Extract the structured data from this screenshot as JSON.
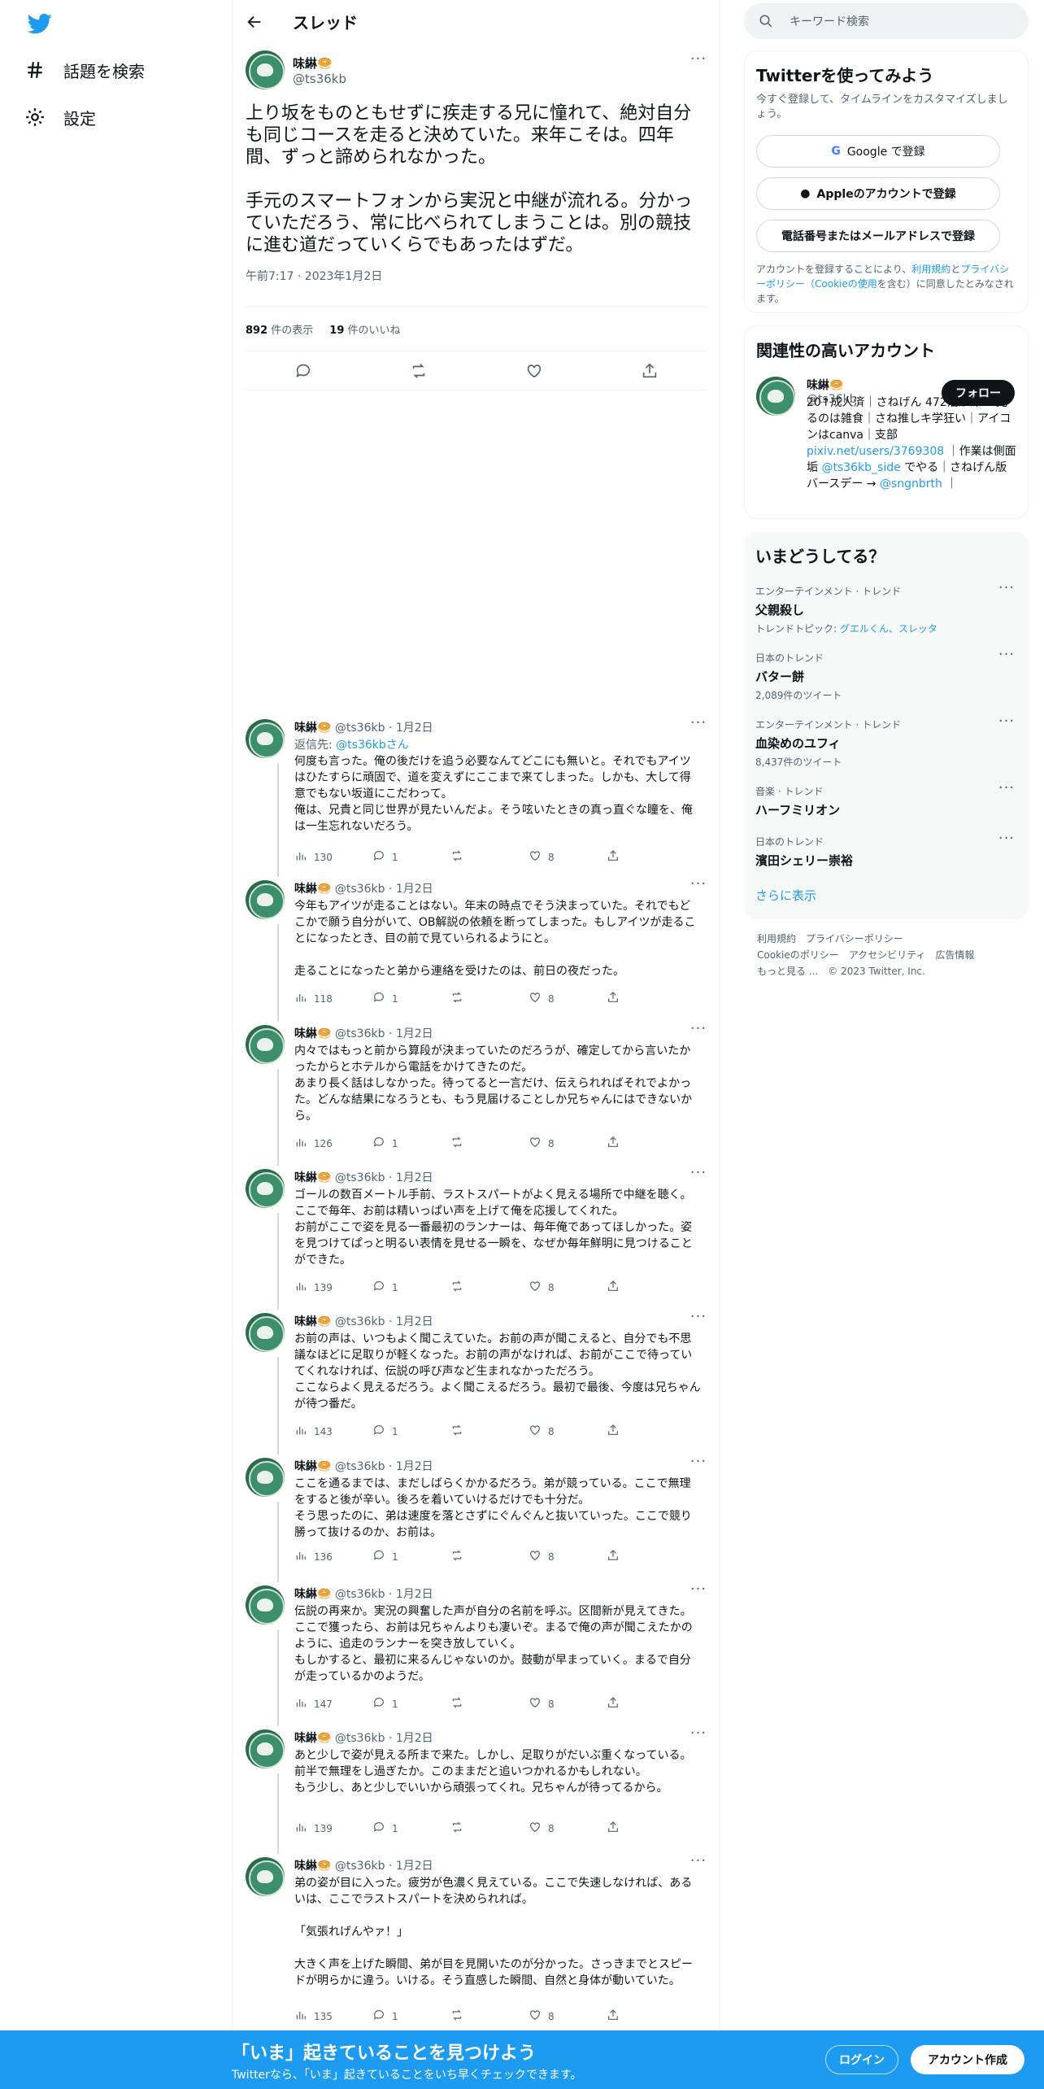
{
  "nav": {
    "explore_label": "話題を検索",
    "settings_label": "設定"
  },
  "header": {
    "title": "スレッド"
  },
  "main_tweet": {
    "name": "味綝🥯",
    "handle": "@ts36kb",
    "text": "上り坂をものともせずに疾走する兄に憧れて、絶対自分も同じコースを走ると決めていた。来年こそは。四年間、ずっと諦められなかった。\n\n手元のスマートフォンから実況と中継が流れる。分かっていただろう、常に比べられてしまうことは。別の競技に進む道だっていくらでもあったはずだ。",
    "time": "午前7:17 · 2023年1月2日",
    "views_count": "892",
    "views_label": " 件の表示",
    "likes_count": "19",
    "likes_label": " 件のいいね"
  },
  "reply_meta": {
    "name": "味綝🥯",
    "handle": "@ts36kb · 1月2日",
    "reply_to_prefix": "返信先: ",
    "reply_to_user": "@ts36kbさん"
  },
  "replies": [
    {
      "text": "何度も言った。俺の後だけを追う必要なんてどこにも無いと。それでもアイツはひたすらに頑固で、道を変えずにここまで来てしまった。しかも、大して得意でもない坂道にこだわって。\n俺は、兄貴と同じ世界が見たいんだよ。そう呟いたときの真っ直ぐな瞳を、俺は一生忘れないだろう。",
      "views": "130",
      "replies": "1",
      "likes": "8"
    },
    {
      "text": "今年もアイツが走ることはない。年末の時点でそう決まっていた。それでもどこかで願う自分がいて、OB解説の依頼を断ってしまった。もしアイツが走ることになったとき、目の前で見ていられるようにと。\n\n走ることになったと弟から連絡を受けたのは、前日の夜だった。",
      "views": "118",
      "replies": "1",
      "likes": "8"
    },
    {
      "text": "内々ではもっと前から算段が決まっていたのだろうが、確定してから言いたかったからとホテルから電話をかけてきたのだ。\nあまり長く話はしなかった。待ってると一言だけ、伝えられればそれでよかった。どんな結果になろうとも、もう見届けることしか兄ちゃんにはできないから。",
      "views": "126",
      "replies": "1",
      "likes": "8"
    },
    {
      "text": "ゴールの数百メートル手前、ラストスパートがよく見える場所で中継を聴く。ここで毎年、お前は精いっぱい声を上げて俺を応援してくれた。\nお前がここで姿を見る一番最初のランナーは、毎年俺であってほしかった。姿を見つけてぱっと明るい表情を見せる一瞬を、なぜか毎年鮮明に見つけることができた。",
      "views": "139",
      "replies": "1",
      "likes": "8"
    },
    {
      "text": "お前の声は、いつもよく聞こえていた。お前の声が聞こえると、自分でも不思議なほどに足取りが軽くなった。お前の声がなければ、お前がここで待っていてくれなければ、伝説の呼び声など生まれなかっただろう。\nここならよく見えるだろう。よく聞こえるだろう。最初で最後、今度は兄ちゃんが待つ番だ。",
      "views": "143",
      "replies": "1",
      "likes": "8"
    },
    {
      "text": "ここを通るまでは、まだしばらくかかるだろう。弟が競っている。ここで無理をすると後が辛い。後ろを着いていけるだけでも十分だ。\nそう思ったのに、弟は速度を落とさずにぐんぐんと抜いていった。ここで競り勝って抜けるのか、お前は。",
      "views": "136",
      "replies": "1",
      "likes": "8"
    },
    {
      "text": "伝説の再来か。実況の興奮した声が自分の名前を呼ぶ。区間新が見えてきた。ここで獲ったら、お前は兄ちゃんよりも凄いぞ。まるで俺の声が聞こえたかのように、追走のランナーを突き放していく。\nもしかすると、最初に来るんじゃないのか。鼓動が早まっていく。まるで自分が走っているかのようだ。",
      "views": "147",
      "replies": "1",
      "likes": "8"
    },
    {
      "text": "あと少しで姿が見える所まで来た。しかし、足取りがだいぶ重くなっている。前半で無理をし過ぎたか。このままだと追いつかれるかもしれない。\nもう少し、あと少しでいいから頑張ってくれ。兄ちゃんが待ってるから。",
      "views": "139",
      "replies": "1",
      "likes": "8"
    },
    {
      "text": "弟の姿が目に入った。疲労が色濃く見えている。ここで失速しなければ、あるいは、ここでラストスパートを決められれば。\n\n「気張れげんやァ！」\n\n大きく声を上げた瞬間、弟が目を見開いたのが分かった。さっきまでとスピードが明らかに違う。いける。そう直感した瞬間、自然と身体が動いていた。",
      "views": "135",
      "replies": "1",
      "likes": "8"
    }
  ],
  "sidebar": {
    "search_placeholder": "キーワード検索",
    "signup": {
      "title": "Twitterを使ってみよう",
      "desc": "今すぐ登録して、タイムラインをカスタマイズしましょう。",
      "google": "Google で登録",
      "apple": "Appleのアカウントで登録",
      "phone": "電話番号またはメールアドレスで登録",
      "legal_prefix": "アカウントを登録することにより、",
      "legal_terms": "利用規約",
      "legal_and": "と",
      "legal_privacy": "プライバシーポリシー",
      "legal_cookie": "（Cookieの使用",
      "legal_suffix": "を含む）に同意したとみなされます。"
    },
    "related": {
      "title": "関連性の高いアカウント",
      "name": "味綝🥯",
      "handle": "@ts36kb",
      "follow": "フォロー",
      "bio_1": "20↑成人済｜さねげん 472沼が深い 見るのは雑食｜さね推しキ学狂い｜アイコンはcanva｜支部",
      "bio_link": "pixiv.net/users/3769308",
      "bio_2": "｜作業は側面垢",
      "bio_link2": "@ts36kb_side",
      "bio_3": "でやる｜さねげん版バースデー →",
      "bio_link3": "@sngnbrth",
      "bio_4": "｜"
    },
    "trends": {
      "title": "いまどうしてる？",
      "items": [
        {
          "category": "エンターテインメント · トレンド",
          "name": "父親殺し",
          "sub_prefix": "トレンドトピック: ",
          "sub_link": "グエルくん、スレッタ",
          "sub": ""
        },
        {
          "category": "日本のトレンド",
          "name": "バター餅",
          "sub_prefix": "",
          "sub_link": "",
          "sub": "2,089件のツイート"
        },
        {
          "category": "エンターテインメント · トレンド",
          "name": "血染めのユフィ",
          "sub_prefix": "",
          "sub_link": "",
          "sub": "8,437件のツイート"
        },
        {
          "category": "音楽 · トレンド",
          "name": "ハーフミリオン",
          "sub_prefix": "",
          "sub_link": "",
          "sub": ""
        },
        {
          "category": "日本のトレンド",
          "name": "濱田シェリー崇裕",
          "sub_prefix": "",
          "sub_link": "",
          "sub": ""
        }
      ],
      "show_more": "さらに表示"
    },
    "footer": {
      "line1": "利用規約　プライバシーポリシー",
      "line2": "Cookieのポリシー　アクセシビリティ　広告情報",
      "line3": "もっと見る ...　© 2023 Twitter, Inc."
    }
  },
  "bottom_bar": {
    "title": "「いま」起きていることを見つけよう",
    "sub": "Twitterなら、「いま」起きていることをいち早くチェックできます。",
    "login": "ログイン",
    "signup": "アカウント作成"
  },
  "colors": {
    "accent": "#1d9bf0",
    "text": "#0f1419",
    "muted": "#536471"
  }
}
